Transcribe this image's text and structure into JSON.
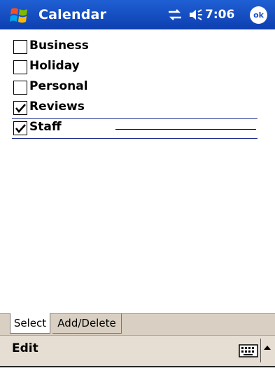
{
  "titlebar": {
    "app_title": "Calendar",
    "clock": "7:06",
    "ok_label": "ok"
  },
  "categories": [
    {
      "label": "Business",
      "checked": false
    },
    {
      "label": "Holiday",
      "checked": false
    },
    {
      "label": "Personal",
      "checked": false
    },
    {
      "label": "Reviews",
      "checked": true
    },
    {
      "label": "Staff",
      "checked": true
    }
  ],
  "tabs": {
    "select": "Select",
    "add_delete": "Add/Delete",
    "active": "Select"
  },
  "menubar": {
    "edit": "Edit"
  },
  "icons": {
    "start": "windows-flag-icon",
    "connectivity": "connectivity-icon",
    "volume": "speaker-icon",
    "keyboard": "keyboard-icon",
    "sip_menu": "up-arrow-icon"
  },
  "colors": {
    "titlebar": "#1b4fcc",
    "selection_line": "#1a2a8a",
    "tab_strip": "#d9cfc2",
    "menubar": "#e6ded3"
  }
}
